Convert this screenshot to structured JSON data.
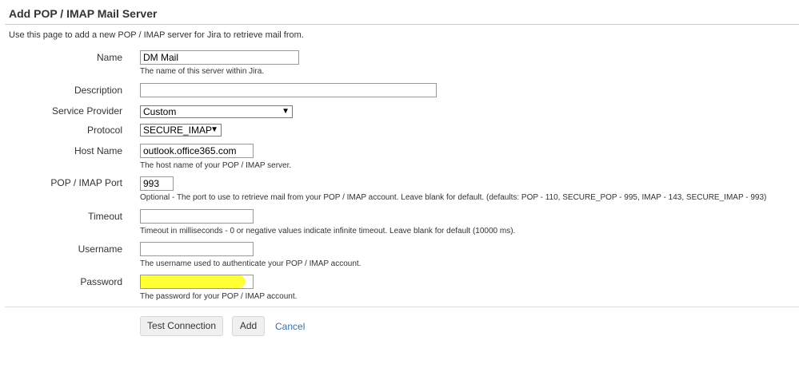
{
  "header": {
    "title": "Add POP / IMAP Mail Server",
    "intro": "Use this page to add a new POP / IMAP server for Jira to retrieve mail from."
  },
  "form": {
    "name": {
      "label": "Name",
      "value": "DM Mail",
      "hint": "The name of this server within Jira."
    },
    "description": {
      "label": "Description",
      "value": ""
    },
    "service_provider": {
      "label": "Service Provider",
      "value": "Custom"
    },
    "protocol": {
      "label": "Protocol",
      "value": "SECURE_IMAP"
    },
    "host_name": {
      "label": "Host Name",
      "value": "outlook.office365.com",
      "hint": "The host name of your POP / IMAP server."
    },
    "port": {
      "label": "POP / IMAP Port",
      "value": "993",
      "hint": "Optional - The port to use to retrieve mail from your POP / IMAP account. Leave blank for default. (defaults: POP - 110, SECURE_POP - 995, IMAP - 143, SECURE_IMAP - 993)"
    },
    "timeout": {
      "label": "Timeout",
      "value": "",
      "hint": "Timeout in milliseconds - 0 or negative values indicate infinite timeout. Leave blank for default (10000 ms)."
    },
    "username": {
      "label": "Username",
      "value": "",
      "hint": "The username used to authenticate your POP / IMAP account."
    },
    "password": {
      "label": "Password",
      "value": "",
      "hint": "The password for your POP / IMAP account.",
      "redaction_color": "#ffff33"
    }
  },
  "actions": {
    "test_connection": "Test Connection",
    "add": "Add",
    "cancel": "Cancel"
  },
  "icons": {
    "dropdown": "chevron-down-icon"
  },
  "colors": {
    "link": "#3572b0",
    "highlight": "#ffff33"
  }
}
